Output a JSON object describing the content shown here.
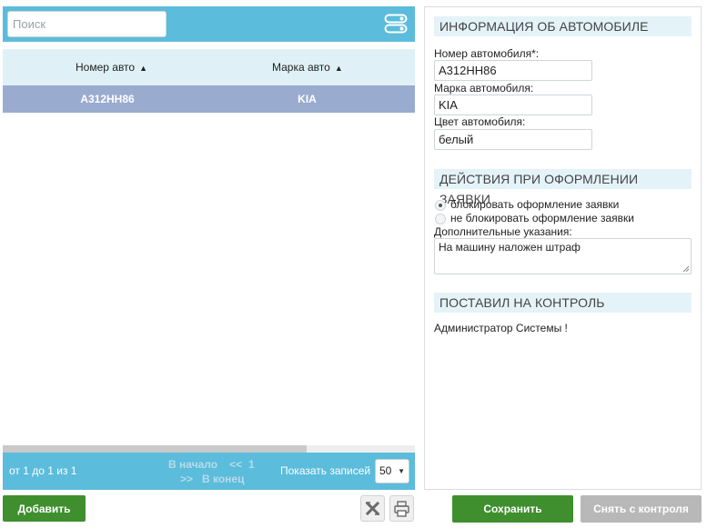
{
  "search": {
    "placeholder": "Поиск",
    "value": ""
  },
  "grid": {
    "columns": [
      {
        "label": "Номер авто",
        "sort_icon": "sort-asc-icon"
      },
      {
        "label": "Марка авто",
        "sort_icon": "sort-asc-icon"
      }
    ],
    "rows": [
      {
        "number": "А312НН86",
        "brand": "KIA"
      }
    ]
  },
  "pager": {
    "info": "от 1 до 1 из 1",
    "first": "В начало",
    "prev": "<<",
    "page": "1",
    "next": ">>",
    "last": "В конец",
    "page_size_label": "Показать записей",
    "page_size": "50"
  },
  "actions": {
    "add": "Добавить",
    "excel_icon": "excel-export-icon",
    "print_icon": "print-icon",
    "save": "Сохранить",
    "remove": "Снять с контроля"
  },
  "car_info": {
    "title": "ИНФОРМАЦИЯ ОБ АВТОМОБИЛЕ",
    "number_label": "Номер автомобиля*:",
    "number_value": "А312НН86",
    "brand_label": "Марка автомобиля:",
    "brand_value": "KIA",
    "color_label": "Цвет автомобиля:",
    "color_value": "белый"
  },
  "order_actions": {
    "title": "ДЕЙСТВИЯ ПРИ ОФОРМЛЕНИИ ЗАЯВКИ",
    "option_block": "блокировать оформление заявки",
    "option_no_block": "не блокировать оформление заявки",
    "selected": "блокировать оформление заявки",
    "notes_label": "Дополнительные указания:",
    "notes_value": "На машину наложен штраф"
  },
  "controller": {
    "title": "ПОСТАВИЛ НА КОНТРОЛЬ",
    "name": "Администратор Системы !"
  },
  "colors": {
    "header_blue": "#5bbcdb",
    "grid_header": "#dff1f6",
    "row_selected": "#9aabd0",
    "section_title_bg": "#e4f3f8",
    "button_green": "#3f8f2f",
    "button_gray": "#b8b8b8"
  }
}
